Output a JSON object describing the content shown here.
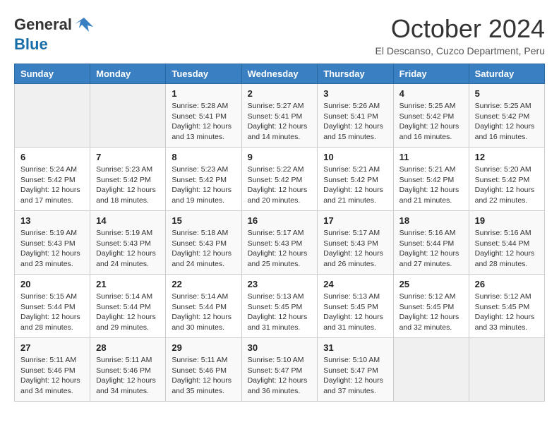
{
  "header": {
    "logo_general": "General",
    "logo_blue": "Blue",
    "month_title": "October 2024",
    "location": "El Descanso, Cuzco Department, Peru"
  },
  "weekdays": [
    "Sunday",
    "Monday",
    "Tuesday",
    "Wednesday",
    "Thursday",
    "Friday",
    "Saturday"
  ],
  "weeks": [
    [
      {
        "day": "",
        "info": ""
      },
      {
        "day": "",
        "info": ""
      },
      {
        "day": "1",
        "info": "Sunrise: 5:28 AM\nSunset: 5:41 PM\nDaylight: 12 hours and 13 minutes."
      },
      {
        "day": "2",
        "info": "Sunrise: 5:27 AM\nSunset: 5:41 PM\nDaylight: 12 hours and 14 minutes."
      },
      {
        "day": "3",
        "info": "Sunrise: 5:26 AM\nSunset: 5:41 PM\nDaylight: 12 hours and 15 minutes."
      },
      {
        "day": "4",
        "info": "Sunrise: 5:25 AM\nSunset: 5:42 PM\nDaylight: 12 hours and 16 minutes."
      },
      {
        "day": "5",
        "info": "Sunrise: 5:25 AM\nSunset: 5:42 PM\nDaylight: 12 hours and 16 minutes."
      }
    ],
    [
      {
        "day": "6",
        "info": "Sunrise: 5:24 AM\nSunset: 5:42 PM\nDaylight: 12 hours and 17 minutes."
      },
      {
        "day": "7",
        "info": "Sunrise: 5:23 AM\nSunset: 5:42 PM\nDaylight: 12 hours and 18 minutes."
      },
      {
        "day": "8",
        "info": "Sunrise: 5:23 AM\nSunset: 5:42 PM\nDaylight: 12 hours and 19 minutes."
      },
      {
        "day": "9",
        "info": "Sunrise: 5:22 AM\nSunset: 5:42 PM\nDaylight: 12 hours and 20 minutes."
      },
      {
        "day": "10",
        "info": "Sunrise: 5:21 AM\nSunset: 5:42 PM\nDaylight: 12 hours and 21 minutes."
      },
      {
        "day": "11",
        "info": "Sunrise: 5:21 AM\nSunset: 5:42 PM\nDaylight: 12 hours and 21 minutes."
      },
      {
        "day": "12",
        "info": "Sunrise: 5:20 AM\nSunset: 5:42 PM\nDaylight: 12 hours and 22 minutes."
      }
    ],
    [
      {
        "day": "13",
        "info": "Sunrise: 5:19 AM\nSunset: 5:43 PM\nDaylight: 12 hours and 23 minutes."
      },
      {
        "day": "14",
        "info": "Sunrise: 5:19 AM\nSunset: 5:43 PM\nDaylight: 12 hours and 24 minutes."
      },
      {
        "day": "15",
        "info": "Sunrise: 5:18 AM\nSunset: 5:43 PM\nDaylight: 12 hours and 24 minutes."
      },
      {
        "day": "16",
        "info": "Sunrise: 5:17 AM\nSunset: 5:43 PM\nDaylight: 12 hours and 25 minutes."
      },
      {
        "day": "17",
        "info": "Sunrise: 5:17 AM\nSunset: 5:43 PM\nDaylight: 12 hours and 26 minutes."
      },
      {
        "day": "18",
        "info": "Sunrise: 5:16 AM\nSunset: 5:44 PM\nDaylight: 12 hours and 27 minutes."
      },
      {
        "day": "19",
        "info": "Sunrise: 5:16 AM\nSunset: 5:44 PM\nDaylight: 12 hours and 28 minutes."
      }
    ],
    [
      {
        "day": "20",
        "info": "Sunrise: 5:15 AM\nSunset: 5:44 PM\nDaylight: 12 hours and 28 minutes."
      },
      {
        "day": "21",
        "info": "Sunrise: 5:14 AM\nSunset: 5:44 PM\nDaylight: 12 hours and 29 minutes."
      },
      {
        "day": "22",
        "info": "Sunrise: 5:14 AM\nSunset: 5:44 PM\nDaylight: 12 hours and 30 minutes."
      },
      {
        "day": "23",
        "info": "Sunrise: 5:13 AM\nSunset: 5:45 PM\nDaylight: 12 hours and 31 minutes."
      },
      {
        "day": "24",
        "info": "Sunrise: 5:13 AM\nSunset: 5:45 PM\nDaylight: 12 hours and 31 minutes."
      },
      {
        "day": "25",
        "info": "Sunrise: 5:12 AM\nSunset: 5:45 PM\nDaylight: 12 hours and 32 minutes."
      },
      {
        "day": "26",
        "info": "Sunrise: 5:12 AM\nSunset: 5:45 PM\nDaylight: 12 hours and 33 minutes."
      }
    ],
    [
      {
        "day": "27",
        "info": "Sunrise: 5:11 AM\nSunset: 5:46 PM\nDaylight: 12 hours and 34 minutes."
      },
      {
        "day": "28",
        "info": "Sunrise: 5:11 AM\nSunset: 5:46 PM\nDaylight: 12 hours and 34 minutes."
      },
      {
        "day": "29",
        "info": "Sunrise: 5:11 AM\nSunset: 5:46 PM\nDaylight: 12 hours and 35 minutes."
      },
      {
        "day": "30",
        "info": "Sunrise: 5:10 AM\nSunset: 5:47 PM\nDaylight: 12 hours and 36 minutes."
      },
      {
        "day": "31",
        "info": "Sunrise: 5:10 AM\nSunset: 5:47 PM\nDaylight: 12 hours and 37 minutes."
      },
      {
        "day": "",
        "info": ""
      },
      {
        "day": "",
        "info": ""
      }
    ]
  ]
}
